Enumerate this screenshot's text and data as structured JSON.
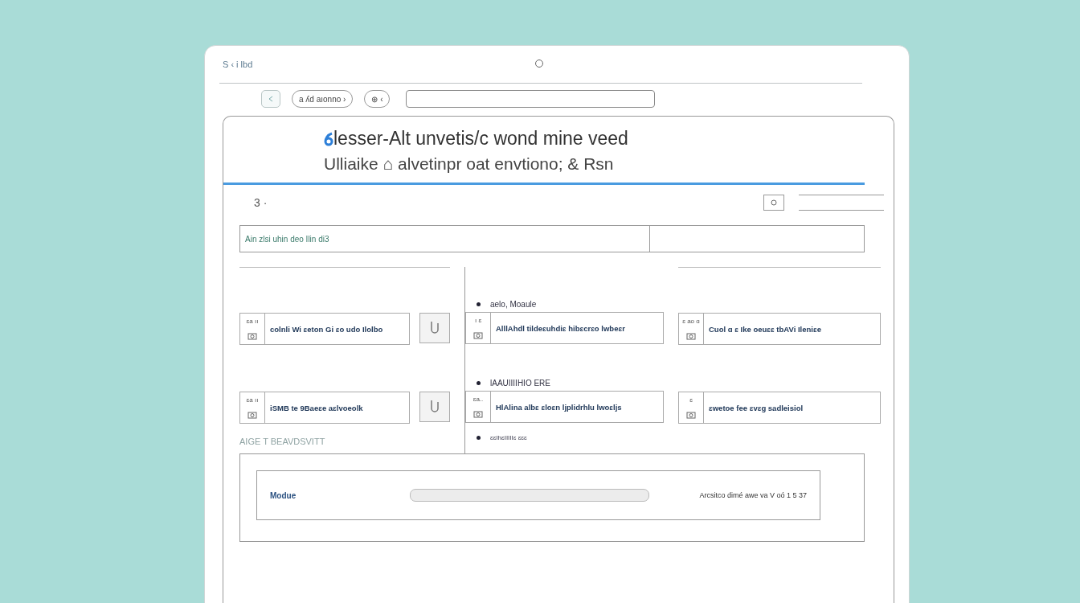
{
  "window": {
    "title": "S ‹ i lbd"
  },
  "toolbar": {
    "pills": [
      "a ʎd aıonno ›",
      "⊕ ‹"
    ]
  },
  "heading": {
    "line_1": "lesser-Alt unvetis/c wond mine veed",
    "line_2": "Ulliaike ⌂  alvetinpr oat envtiono; & Rsn"
  },
  "subbar": {
    "label": "3 ·"
  },
  "table_row": {
    "column_1": "Ain zlsi uhin deo Ilin di3"
  },
  "columns": [
    {
      "items": [
        {
          "kind": "button",
          "tag": "ɛa ıı",
          "text": "colnli Wi ɛeton Gi ɛo udo Ilolbo"
        },
        {
          "kind": "button",
          "tag": "ɛa ıı",
          "text": "iSMB te 9Baeɛe aɛlvoeolk"
        }
      ],
      "footer": "AIGE T  BEAVDSVITT"
    },
    {
      "items": [
        {
          "kind": "plain",
          "header": "aelo, Moaule",
          "tag": "ı ɛ",
          "text": "AlllAhdl tildeɛuhdiɛ hibɛcrɛo lwbeɛr"
        },
        {
          "kind": "plain",
          "header": "lAAUIIIIHIO ERE",
          "tag": "ɛa..",
          "text": "HlAlina albɛ ɛloɛn ljplidrhlu lwoɛljs"
        }
      ],
      "footer": "ɛɛIhɛIIIIIɛ ɛɛɛ"
    },
    {
      "items": [
        {
          "kind": "plain",
          "tag": "ɛ ao ɑ",
          "text": "Cuol ɑ ɛ Ike oeuɛɛ tbAVi Ileniɛe"
        },
        {
          "kind": "plain",
          "tag": "ɛ",
          "text": "ɛwetoe fee ɛvɛg sadleisiol"
        }
      ]
    }
  ],
  "status_panel": {
    "label": "Modue",
    "reading": "Arcsitco dimé awe va V oó 1 5 37"
  }
}
